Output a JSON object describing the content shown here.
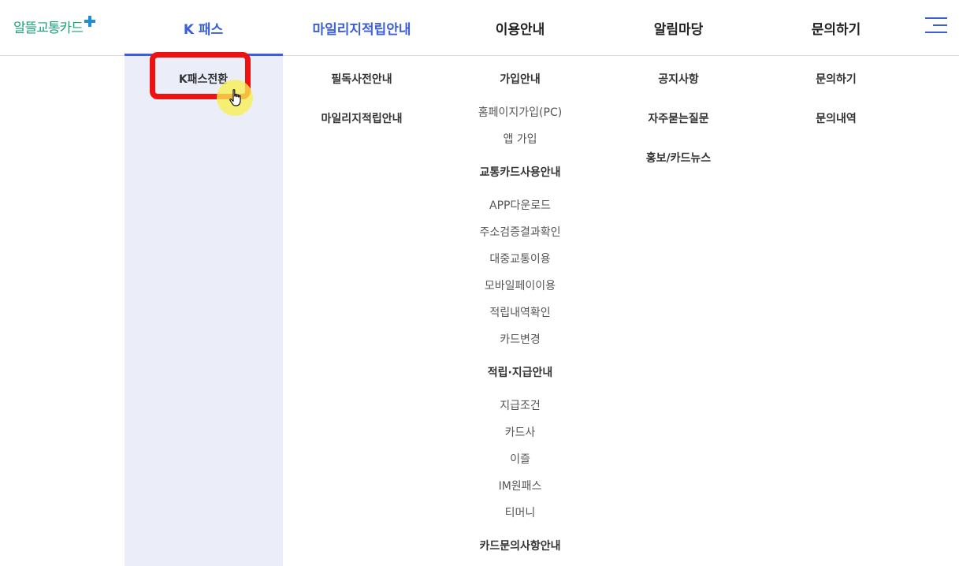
{
  "logo": {
    "text": "알뜰교통카드"
  },
  "nav": {
    "items": [
      {
        "label": "K 패스"
      },
      {
        "label": "마일리지적립안내"
      },
      {
        "label": "이용안내"
      },
      {
        "label": "알림마당"
      },
      {
        "label": "문의하기"
      }
    ],
    "menu_icon": "hamburger-menu-icon"
  },
  "dropdown": {
    "kpass": {
      "items": [
        "K패스전환"
      ]
    },
    "mileage": {
      "items": [
        "필독사전안내",
        "마일리지적립안내"
      ]
    },
    "usage": {
      "join_heading": "가입안내",
      "join_items": [
        "홈페이지가입(PC)",
        "앱 가입"
      ],
      "card_heading": "교통카드사용안내",
      "card_items": [
        "APP다운로드",
        "주소검증결과확인",
        "대중교통이용",
        "모바일페이이용",
        "적립내역확인",
        "카드변경"
      ],
      "earn_heading": "적립·지급안내",
      "earn_items": [
        "지급조건",
        "카드사",
        "이즐",
        "IM원패스",
        "티머니"
      ],
      "inquiry_heading": "카드문의사항안내"
    },
    "notice": {
      "items": [
        "공지사항",
        "자주묻는질문",
        "홍보/카드뉴스"
      ]
    },
    "contact": {
      "items": [
        "문의하기",
        "문의내역"
      ]
    }
  },
  "colors": {
    "accent": "#3a5fd8",
    "logo_green": "#1aa27a",
    "logo_plus": "#1e8fd6",
    "panel_bg": "#ebeef9",
    "highlight": "#ee1111",
    "cursor_halo": "#f8f050"
  }
}
